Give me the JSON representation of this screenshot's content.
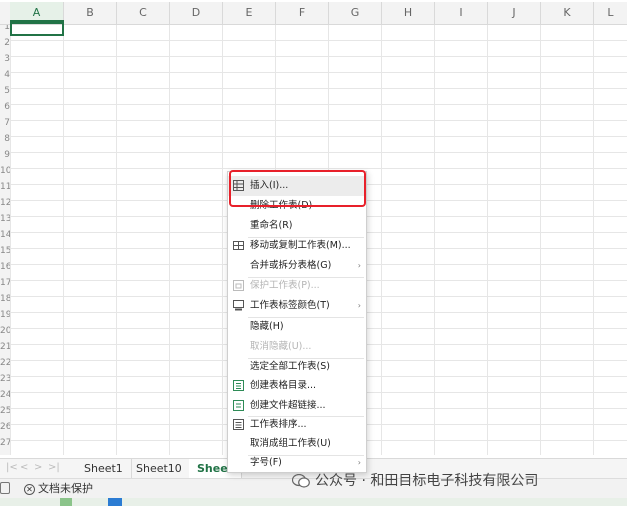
{
  "columns": [
    "A",
    "B",
    "C",
    "D",
    "E",
    "F",
    "G",
    "H",
    "I",
    "J",
    "K",
    "L"
  ],
  "row_numbers": [
    "1",
    "2",
    "3",
    "4",
    "5",
    "6",
    "7",
    "8",
    "9",
    "10",
    "11",
    "12",
    "13",
    "14",
    "15",
    "16",
    "17",
    "18",
    "19",
    "20",
    "21",
    "22",
    "23",
    "24",
    "25",
    "26",
    "27"
  ],
  "sheet_tabs": {
    "nav": [
      "|<",
      "<",
      ">",
      ">|"
    ],
    "tabs": [
      "Sheet1",
      "Sheet10",
      "Sheet"
    ]
  },
  "status_bar": {
    "protection": "文档未保护"
  },
  "context_menu": {
    "items": [
      {
        "label": "插入(I)...",
        "icon": "insert-grid-icon",
        "state": "hover"
      },
      {
        "label": "删除工作表(D)",
        "icon": "",
        "state": "normal"
      },
      {
        "label": "重命名(R)",
        "icon": "",
        "state": "normal"
      },
      {
        "label": "移动或复制工作表(M)...",
        "icon": "move-copy-icon",
        "state": "normal"
      },
      {
        "label": "合并或拆分表格(G)",
        "icon": "",
        "state": "normal",
        "submenu": true
      },
      {
        "label": "保护工作表(P)...",
        "icon": "protect-sheet-icon",
        "state": "disabled"
      },
      {
        "label": "工作表标签颜色(T)",
        "icon": "tab-color-icon",
        "state": "normal",
        "submenu": true
      },
      {
        "label": "隐藏(H)",
        "icon": "",
        "state": "normal"
      },
      {
        "label": "取消隐藏(U)...",
        "icon": "",
        "state": "disabled"
      },
      {
        "label": "选定全部工作表(S)",
        "icon": "",
        "state": "normal"
      },
      {
        "label": "创建表格目录...",
        "icon": "table-directory-icon",
        "state": "normal"
      },
      {
        "label": "创建文件超链接...",
        "icon": "file-hyperlink-icon",
        "state": "normal"
      },
      {
        "label": "工作表排序...",
        "icon": "sort-sheets-icon",
        "state": "normal"
      },
      {
        "label": "取消成组工作表(U)",
        "icon": "",
        "state": "normal"
      },
      {
        "label": "字号(F)",
        "icon": "",
        "state": "normal",
        "submenu": true
      }
    ],
    "submenu_arrow": "›"
  },
  "watermark": {
    "text": "公众号 · 和田目标电子科技有限公司"
  },
  "colors": {
    "accent": "#217346",
    "highlight": "#e8202a"
  }
}
